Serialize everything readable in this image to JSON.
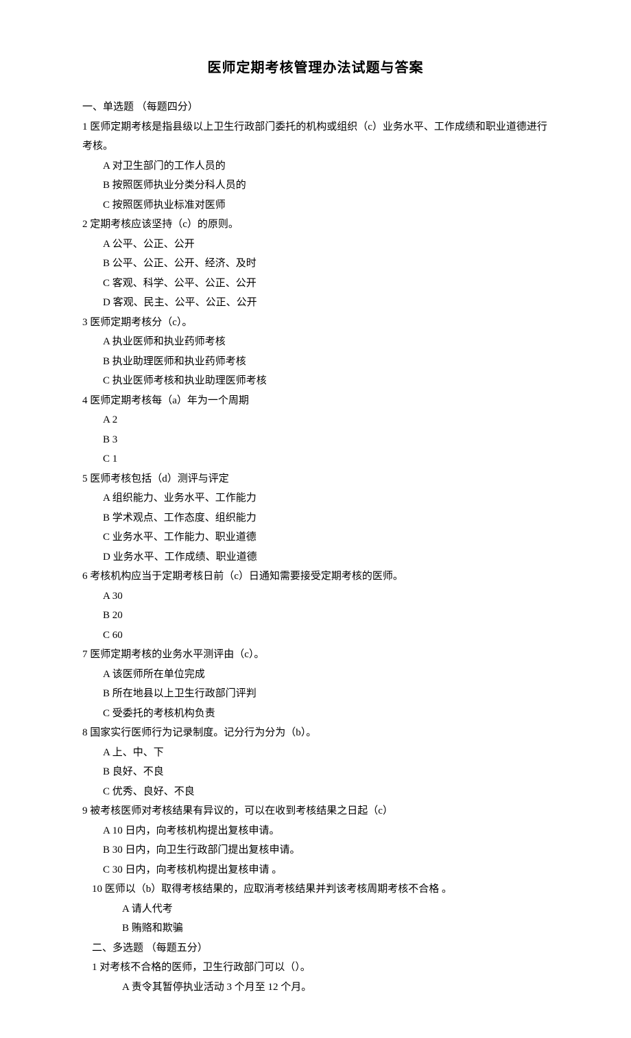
{
  "title": "医师定期考核管理办法试题与答案",
  "section1_head": "一、单选题 （每题四分）",
  "q1": "1 医师定期考核是指县级以上卫生行政部门委托的机构或组织（c）业务水平、工作成绩和职业道德进行考核。",
  "q1_A": "A 对卫生部门的工作人员的",
  "q1_B": "B 按照医师执业分类分科人员的",
  "q1_C": "C 按照医师执业标准对医师",
  "q2": "2 定期考核应该坚持（c）的原则。",
  "q2_A": "A 公平、公正、公开",
  "q2_B": "B 公平、公正、公开、经济、及时",
  "q2_C": "C 客观、科学、公平、公正、公开",
  "q2_D": "D 客观、民主、公平、公正、公开",
  "q3": "3 医师定期考核分（c）。",
  "q3_A": "A 执业医师和执业药师考核",
  "q3_B": "B 执业助理医师和执业药师考核",
  "q3_C": "C 执业医师考核和执业助理医师考核",
  "q4": "4 医师定期考核每（a）年为一个周期",
  "q4_A": "A 2",
  "q4_B": "B 3",
  "q4_C": "C 1",
  "q5": "5 医师考核包括（d）测评与评定",
  "q5_A": "A 组织能力、业务水平、工作能力",
  "q5_B": "B 学术观点、工作态度、组织能力",
  "q5_C": "C  业务水平、工作能力、职业道德",
  "q5_D": "D  业务水平、工作成绩、职业道德",
  "q6": "6 考核机构应当于定期考核日前（c）日通知需要接受定期考核的医师。",
  "q6_A": "A 30",
  "q6_B": "B 20",
  "q6_C": "C 60",
  "q7": "7 医师定期考核的业务水平测评由（c）。",
  "q7_A": "A 该医师所在单位完成",
  "q7_B": "B 所在地县以上卫生行政部门评判",
  "q7_C": "C 受委托的考核机构负责",
  "q8": "8 国家实行医师行为记录制度。记分行为分为（b）。",
  "q8_A": "A 上、中、下",
  "q8_B": "B 良好、不良",
  "q8_C": "C 优秀、良好、不良",
  "q9": "9 被考核医师对考核结果有异议的，可以在收到考核结果之日起（c）",
  "q9_A": "A 10 日内，向考核机构提出复核申请。",
  "q9_B": "B 30 日内，向卫生行政部门提出复核申请。",
  "q9_C": "C 30 日内，向考核机构提出复核申请 。",
  "q10": "10 医师以（b）取得考核结果的，应取消考核结果并判该考核周期考核不合格 。",
  "q10_A": "A 请人代考",
  "q10_B": "B 贿赂和欺骗",
  "section2_head": "二、多选题 （每题五分）",
  "s2_q1": "1 对考核不合格的医师，卫生行政部门可以（）。",
  "s2_q1_A": "A 责令其暂停执业活动 3 个月至 12 个月。"
}
